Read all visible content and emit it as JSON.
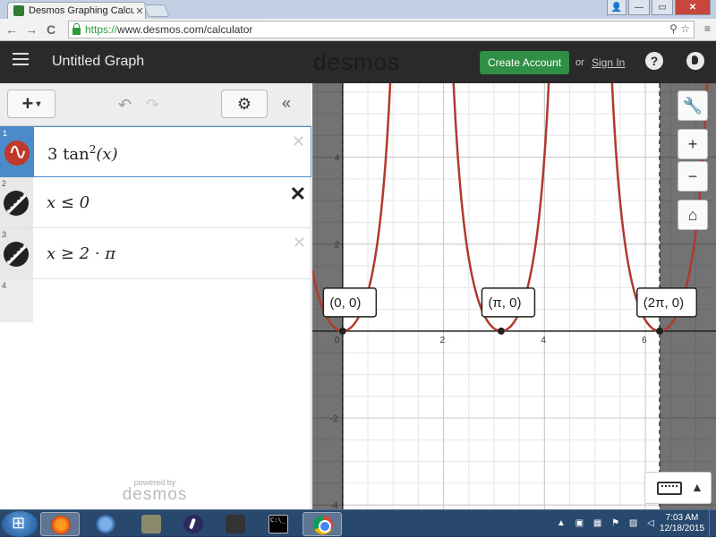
{
  "browser": {
    "tab_title": "Desmos Graphing Calcula",
    "tab_close": "✕",
    "window_buttons": {
      "minimize": "—",
      "maximize": "▭",
      "close": "✕",
      "user": "👤"
    },
    "nav": {
      "back": "←",
      "forward": "→",
      "reload": "C"
    },
    "url_scheme": "https://",
    "url_rest": "www.desmos.com/calculator",
    "url_icons": "⚲ ☆",
    "menu": "≡"
  },
  "header": {
    "title": "Untitled Graph",
    "logo": "desmos",
    "create_account": "Create Account",
    "or": "or",
    "sign_in": "Sign In",
    "help": "?"
  },
  "toolbar": {
    "add": "+",
    "add_caret": "▾",
    "undo": "↶",
    "redo": "↷",
    "settings": "⚙",
    "collapse": "«"
  },
  "expressions": [
    {
      "num": "1",
      "coef": "3",
      "func": "tan",
      "exp": "2",
      "arg": "(x)",
      "delete": "✕",
      "icon": "sine-wave-icon"
    },
    {
      "num": "2",
      "text": "x ≤ 0",
      "delete": "✕",
      "icon": "inequality-icon"
    },
    {
      "num": "3",
      "text": "x ≥ 2 · π",
      "delete": "✕",
      "icon": "inequality-icon"
    },
    {
      "num": "4"
    }
  ],
  "powered": {
    "line1": "powered by",
    "line2": "desmos"
  },
  "graph": {
    "x_ticks": [
      0,
      2,
      4,
      6
    ],
    "y_ticks": [
      4,
      2,
      -2,
      -4
    ],
    "x_range": [
      -0.6,
      7.4
    ],
    "y_range": [
      -4.1,
      5.7
    ],
    "curve": "3*tan(x)^2",
    "curve_color": "#b03a2e",
    "shaded_regions": [
      "x <= 0",
      "x >= 2π"
    ],
    "points": [
      {
        "label": "(0, 0)",
        "x": 0,
        "y": 0
      },
      {
        "label": "(π, 0)",
        "x": 3.14159,
        "y": 0
      },
      {
        "label": "(2π, 0)",
        "x": 6.28319,
        "y": 0
      }
    ]
  },
  "graph_tools": {
    "wrench": "🔧",
    "zoom_in": "+",
    "zoom_out": "−",
    "home": "⌂",
    "keyboard_toggle": "▲"
  },
  "taskbar": {
    "tray": "▲ ▣ ▦ ⚑ ▨ ◁",
    "time": "7:03 AM",
    "date": "12/18/2015"
  }
}
